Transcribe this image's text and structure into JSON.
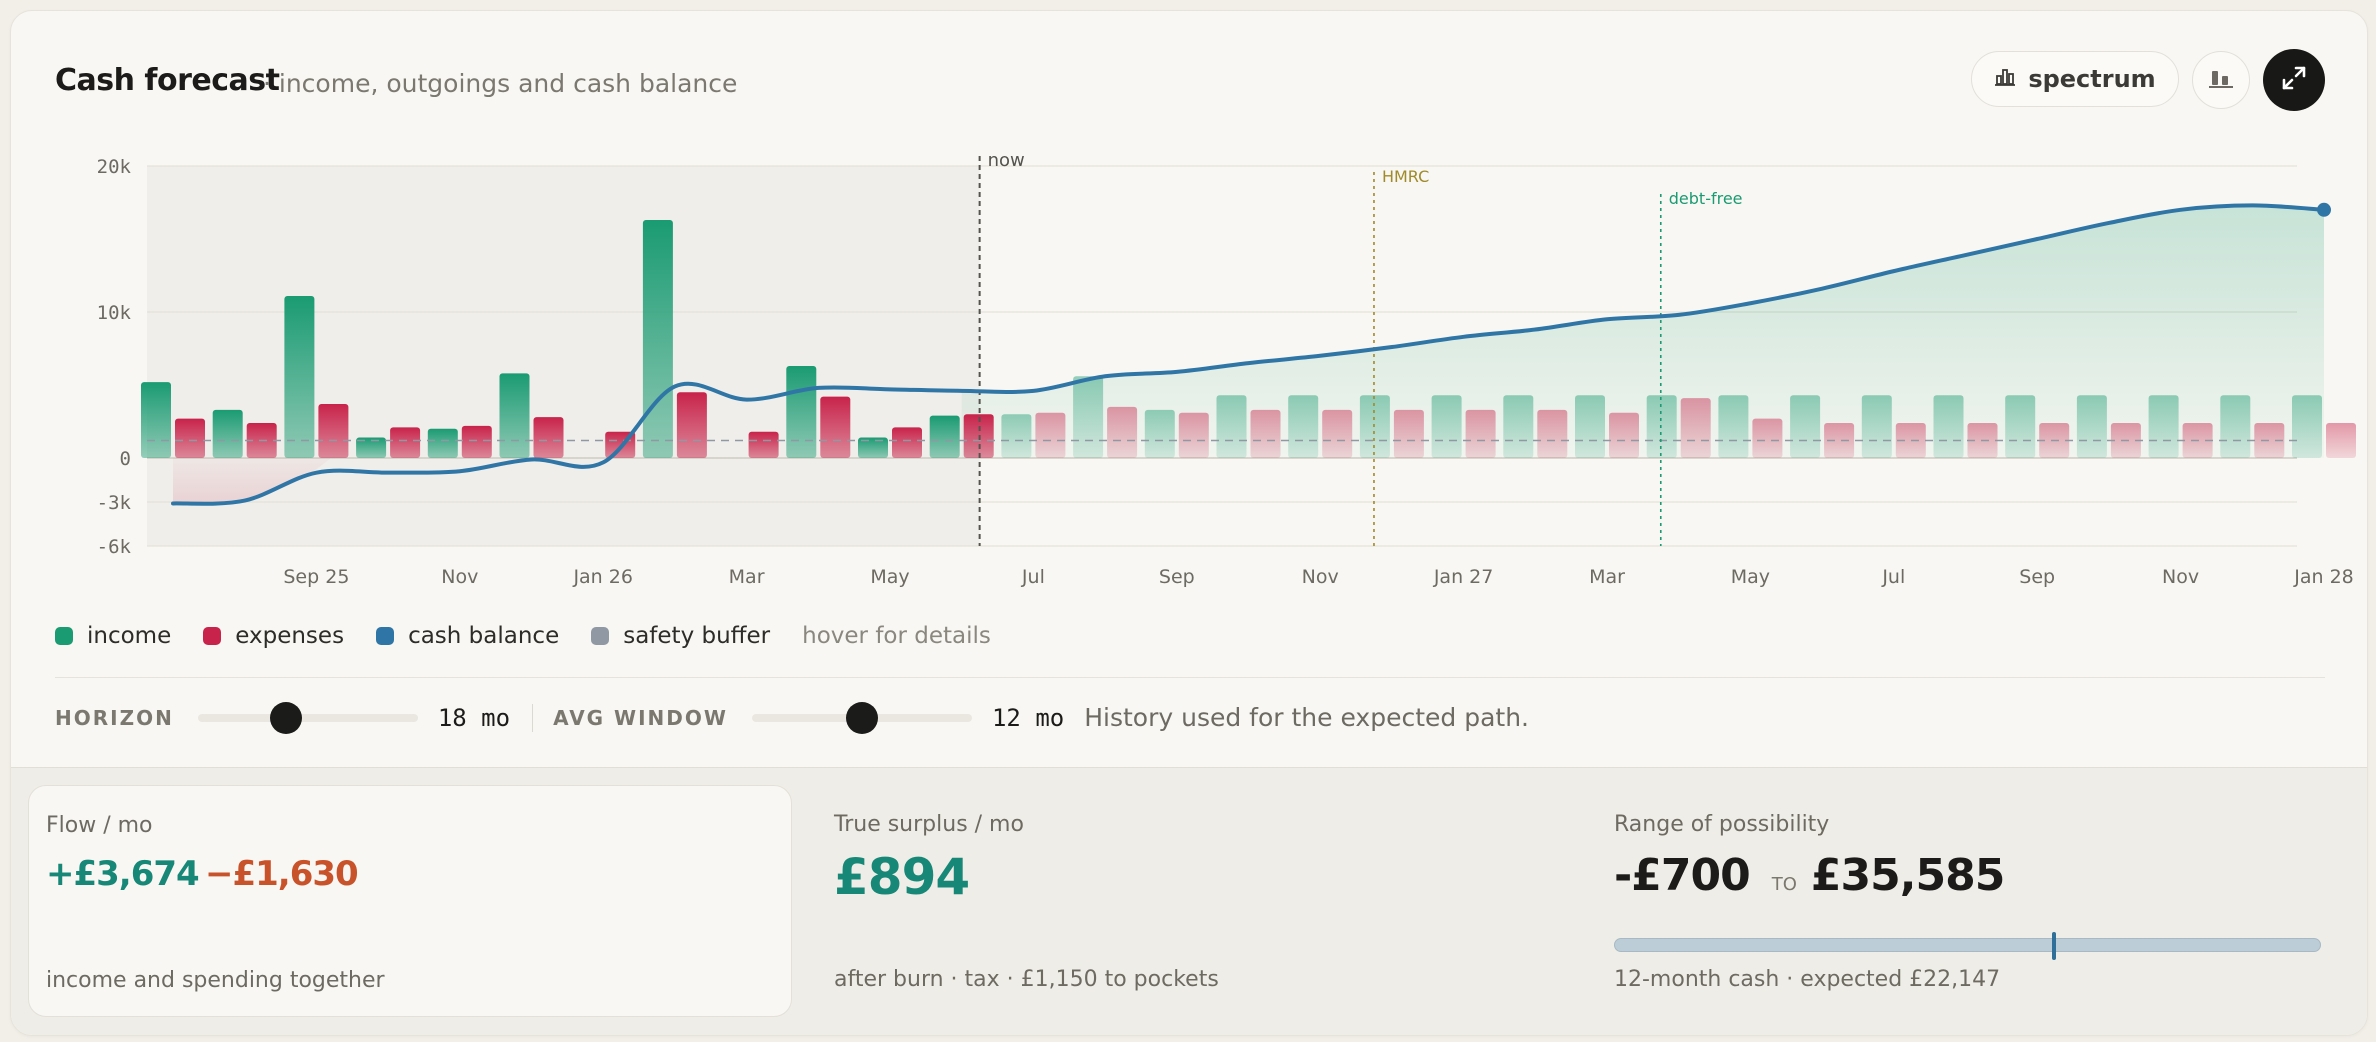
{
  "header": {
    "title": "Cash forecast",
    "subtitle": "· income, outgoings and cash balance",
    "view_button_label": "spectrum"
  },
  "colors": {
    "income": "#1a9b72",
    "expenses": "#c8234a",
    "cash_balance": "#2f76a6",
    "safety_buffer": "#8f98a3",
    "negative_orange": "#c8522a",
    "surplus_teal": "#178877"
  },
  "chart_data": {
    "type": "bar",
    "ylim": [
      -6000,
      20000
    ],
    "yticks": [
      "20k",
      "10k",
      "0",
      "-3k",
      "-6k"
    ],
    "ytick_values": [
      20000,
      10000,
      0,
      -3000,
      -6000
    ],
    "xticks": [
      "Sep 25",
      "Nov",
      "Jan 26",
      "Mar",
      "May",
      "Jul",
      "Sep",
      "Nov",
      "Jan 27",
      "Mar",
      "May",
      "Jul",
      "Sep",
      "Nov",
      "Jan 28"
    ],
    "xtick_months": [
      3,
      5,
      7,
      9,
      11,
      13,
      15,
      17,
      19,
      21,
      23,
      25,
      27,
      29,
      31
    ],
    "markers": [
      {
        "label": "now",
        "month": 12.25
      },
      {
        "label": "HMRC",
        "month": 17.75
      },
      {
        "label": "debt-free",
        "month": 21.75
      }
    ],
    "safety_buffer": 1200,
    "series": [
      {
        "name": "income",
        "months": [
          1,
          2,
          3,
          4,
          5,
          6,
          7,
          8,
          9,
          10,
          11,
          12,
          13,
          14,
          15,
          16,
          17,
          18,
          19,
          20,
          21,
          22,
          23,
          24,
          25,
          26,
          27,
          28,
          29,
          30,
          31
        ],
        "values": [
          5200,
          3300,
          11100,
          1400,
          2000,
          5800,
          0,
          16300,
          0,
          6300,
          1400,
          2900,
          3000,
          5600,
          3300,
          4300,
          4300,
          4300,
          4300,
          4300,
          4300,
          4300,
          4300,
          4300,
          4300,
          4300,
          4300,
          4300,
          4300,
          4300,
          4300
        ]
      },
      {
        "name": "expenses",
        "months": [
          1,
          2,
          3,
          4,
          5,
          6,
          7,
          8,
          9,
          10,
          11,
          12,
          13,
          14,
          15,
          16,
          17,
          18,
          19,
          20,
          21,
          22,
          23,
          24,
          25,
          26,
          27,
          28,
          29,
          30,
          31
        ],
        "values": [
          2700,
          2400,
          3700,
          2100,
          2200,
          2800,
          1800,
          4500,
          1800,
          4200,
          2100,
          3000,
          3100,
          3500,
          3100,
          3300,
          3300,
          3300,
          3300,
          3300,
          3100,
          4100,
          2700,
          2400,
          2400,
          2400,
          2400,
          2400,
          2400,
          2400,
          2400
        ]
      },
      {
        "name": "cash balance",
        "months": [
          1,
          2,
          3,
          4,
          5,
          6,
          7,
          8,
          9,
          10,
          11,
          12,
          13,
          14,
          15,
          16,
          17,
          18,
          19,
          20,
          21,
          22,
          23,
          24,
          25,
          26,
          27,
          28,
          29,
          30,
          31
        ],
        "values": [
          -3100,
          -2900,
          -1000,
          -1000,
          -900,
          -100,
          -300,
          4900,
          4000,
          4800,
          4700,
          4600,
          4600,
          5600,
          5900,
          6500,
          7000,
          7600,
          8300,
          8800,
          9500,
          9800,
          10600,
          11600,
          12800,
          13900,
          15000,
          16100,
          17000,
          17300,
          17000
        ]
      }
    ]
  },
  "legend": {
    "items": [
      {
        "label": "income"
      },
      {
        "label": "expenses"
      },
      {
        "label": "cash balance"
      },
      {
        "label": "safety buffer"
      }
    ],
    "hint": "hover for details"
  },
  "controls": {
    "horizon_label": "HORIZON",
    "horizon_value": "18 mo",
    "horizon_level": 0.4,
    "avg_label": "AVG WINDOW",
    "avg_value": "12 mo",
    "avg_level": 0.5,
    "avg_note": "History used for the expected path."
  },
  "stats": {
    "flow": {
      "label": "Flow / mo",
      "in": "+£3,674",
      "out": "−£1,630",
      "foot": "income and spending together"
    },
    "surplus": {
      "label": "True surplus / mo",
      "value": "£894",
      "foot": "after burn · tax · £1,150 to pockets"
    },
    "range": {
      "label": "Range of possibility",
      "low": "-£700",
      "to": "TO",
      "high": "£35,585",
      "foot": "12-month cash · expected £22,147",
      "expected_fraction": 0.62
    }
  }
}
